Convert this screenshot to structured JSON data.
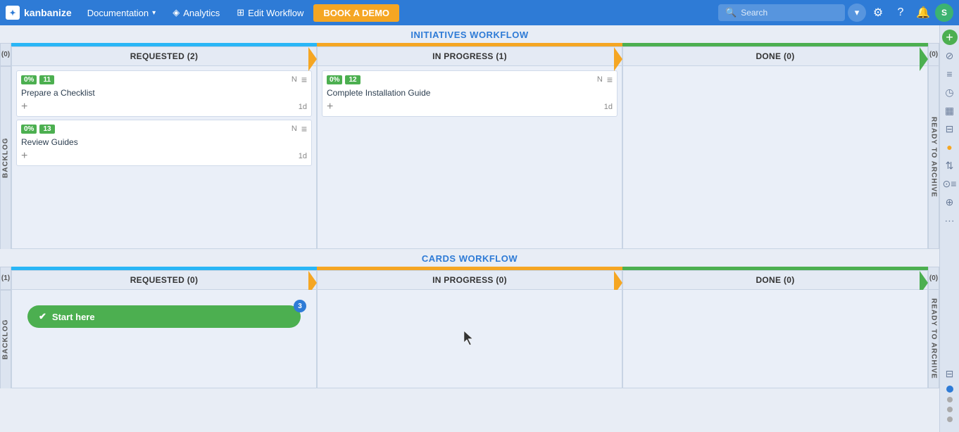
{
  "navbar": {
    "brand": "kanbanize",
    "nav_items": [
      {
        "label": "Documentation",
        "has_dropdown": true
      },
      {
        "label": "Analytics",
        "has_icon": true
      },
      {
        "label": "Edit Workflow",
        "has_icon": true
      }
    ],
    "book_demo": "BOOK A DEMO",
    "search_placeholder": "Search",
    "avatar_letter": "S"
  },
  "board": {
    "workflow1_title": "INITIATIVES WORKFLOW",
    "workflow2_title": "CARDS WORKFLOW",
    "columns": [
      {
        "id": "requested",
        "label": "REQUESTED",
        "count1": 2,
        "count2": 0,
        "bar_class": "requested-bar"
      },
      {
        "id": "inprogress",
        "label": "IN PROGRESS",
        "count1": 1,
        "count2": 0,
        "bar_class": "inprogress-bar"
      },
      {
        "id": "done",
        "label": "DONE",
        "count1": 0,
        "count2": 0,
        "bar_class": "done-bar"
      }
    ],
    "side_counts_init": {
      "left": "0",
      "right": "0"
    },
    "side_counts_cards": {
      "left": "1",
      "right": "0"
    },
    "backlog_label": "BACKLOG",
    "ready_label": "READY TO ARCHIVE",
    "cards_init": [
      {
        "percent": "0%",
        "id": "11",
        "title": "Prepare a Checklist",
        "duration": "1d",
        "col": "requested"
      },
      {
        "percent": "0%",
        "id": "13",
        "title": "Review Guides",
        "duration": "1d",
        "col": "requested"
      },
      {
        "percent": "0%",
        "id": "12",
        "title": "Complete Installation Guide",
        "duration": "1d",
        "col": "inprogress"
      }
    ],
    "start_here_label": "Start here",
    "start_here_badge": "3"
  }
}
